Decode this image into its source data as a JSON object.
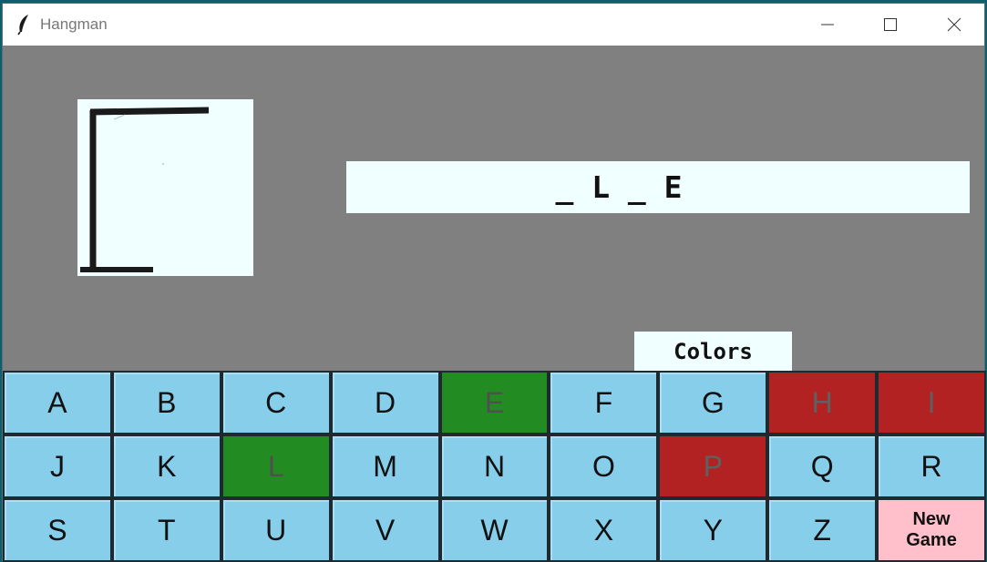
{
  "window": {
    "title": "Hangman"
  },
  "word_display": "_ L _ E",
  "colors_button": "Colors",
  "keyboard": {
    "keys": [
      {
        "letter": "A",
        "state": "unused"
      },
      {
        "letter": "B",
        "state": "unused"
      },
      {
        "letter": "C",
        "state": "unused"
      },
      {
        "letter": "D",
        "state": "unused"
      },
      {
        "letter": "E",
        "state": "correct"
      },
      {
        "letter": "F",
        "state": "unused"
      },
      {
        "letter": "G",
        "state": "unused"
      },
      {
        "letter": "H",
        "state": "wrong"
      },
      {
        "letter": "I",
        "state": "wrong"
      },
      {
        "letter": "J",
        "state": "unused"
      },
      {
        "letter": "K",
        "state": "unused"
      },
      {
        "letter": "L",
        "state": "correct"
      },
      {
        "letter": "M",
        "state": "unused"
      },
      {
        "letter": "N",
        "state": "unused"
      },
      {
        "letter": "O",
        "state": "unused"
      },
      {
        "letter": "P",
        "state": "wrong"
      },
      {
        "letter": "Q",
        "state": "unused"
      },
      {
        "letter": "R",
        "state": "unused"
      },
      {
        "letter": "S",
        "state": "unused"
      },
      {
        "letter": "T",
        "state": "unused"
      },
      {
        "letter": "U",
        "state": "unused"
      },
      {
        "letter": "V",
        "state": "unused"
      },
      {
        "letter": "W",
        "state": "unused"
      },
      {
        "letter": "X",
        "state": "unused"
      },
      {
        "letter": "Y",
        "state": "unused"
      },
      {
        "letter": "Z",
        "state": "unused"
      }
    ],
    "new_game_line1": "New",
    "new_game_line2": "Game"
  },
  "colors": {
    "background": "#808080",
    "panel": "#f0ffff",
    "key": "#87ceeb",
    "correct": "#228b22",
    "wrong": "#b22222",
    "new_game": "#ffc0cb"
  },
  "icons": {
    "app": "feather-icon",
    "minimize": "minimize-icon",
    "maximize": "maximize-icon",
    "close": "close-icon"
  }
}
